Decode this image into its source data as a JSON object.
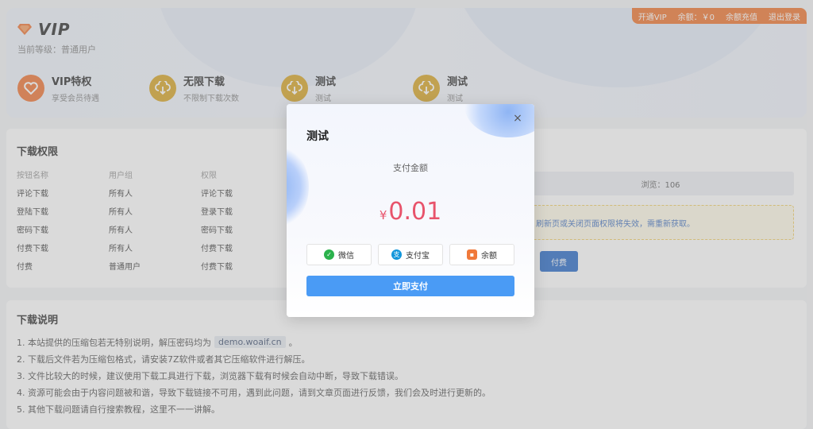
{
  "header": {
    "logo_text": "VIP",
    "level_label": "当前等级：普通用户"
  },
  "topbar": {
    "open_vip": "开通VIP",
    "balance": "余额：￥0",
    "recharge": "余额充值",
    "logout": "退出登录"
  },
  "privileges": [
    {
      "title": "VIP特权",
      "sub": "享受会员待遇",
      "icon": "heart-badge-icon",
      "color": "#f0793a"
    },
    {
      "title": "无限下载",
      "sub": "不限制下载次数",
      "icon": "cloud-download-icon",
      "color": "#d9a82c"
    },
    {
      "title": "测试",
      "sub": "测试",
      "icon": "cloud-download-icon",
      "color": "#d9a82c"
    },
    {
      "title": "测试",
      "sub": "测试",
      "icon": "cloud-download-icon",
      "color": "#d9a82c"
    }
  ],
  "permissions": {
    "title": "下载权限",
    "headers": [
      "按钮名称",
      "用户组",
      "权限"
    ],
    "rows": [
      [
        "评论下载",
        "所有人",
        "评论下载"
      ],
      [
        "登陆下载",
        "所有人",
        "登录下载"
      ],
      [
        "密码下载",
        "所有人",
        "密码下载"
      ],
      [
        "付费下载",
        "所有人",
        "付费下载"
      ],
      [
        "付费",
        "普通用户",
        "付费下载"
      ]
    ],
    "views": "浏览：106",
    "notice": "刷新页或关闭页面权限将失效，需重新获取。",
    "pay_button": "付费"
  },
  "description": {
    "title": "下载说明",
    "item1_pre": "1. 本站提供的压缩包若无特别说明，解压密码均为",
    "item1_code": "demo.woaif.cn",
    "item1_post": "。",
    "item2": "2. 下载后文件若为压缩包格式，请安装7Z软件或者其它压缩软件进行解压。",
    "item3": "3. 文件比较大的时候，建议使用下载工具进行下载，浏览器下载有时候会自动中断，导致下载错误。",
    "item4": "4. 资源可能会由于内容问题被和谐，导致下载链接不可用，遇到此问题，请到文章页面进行反馈，我们会及时进行更新的。",
    "item5": "5. 其他下载问题请自行搜索教程，这里不一一讲解。"
  },
  "modal": {
    "title": "测试",
    "amount_label": "支付金额",
    "currency": "¥",
    "amount": "0.01",
    "methods": [
      {
        "label": "微信",
        "icon": "wechat-icon",
        "color": "#2bb24c"
      },
      {
        "label": "支付宝",
        "icon": "alipay-icon",
        "color": "#1296db"
      },
      {
        "label": "余额",
        "icon": "wallet-icon",
        "color": "#f0793a"
      }
    ],
    "pay_now": "立即支付",
    "close": "×"
  }
}
